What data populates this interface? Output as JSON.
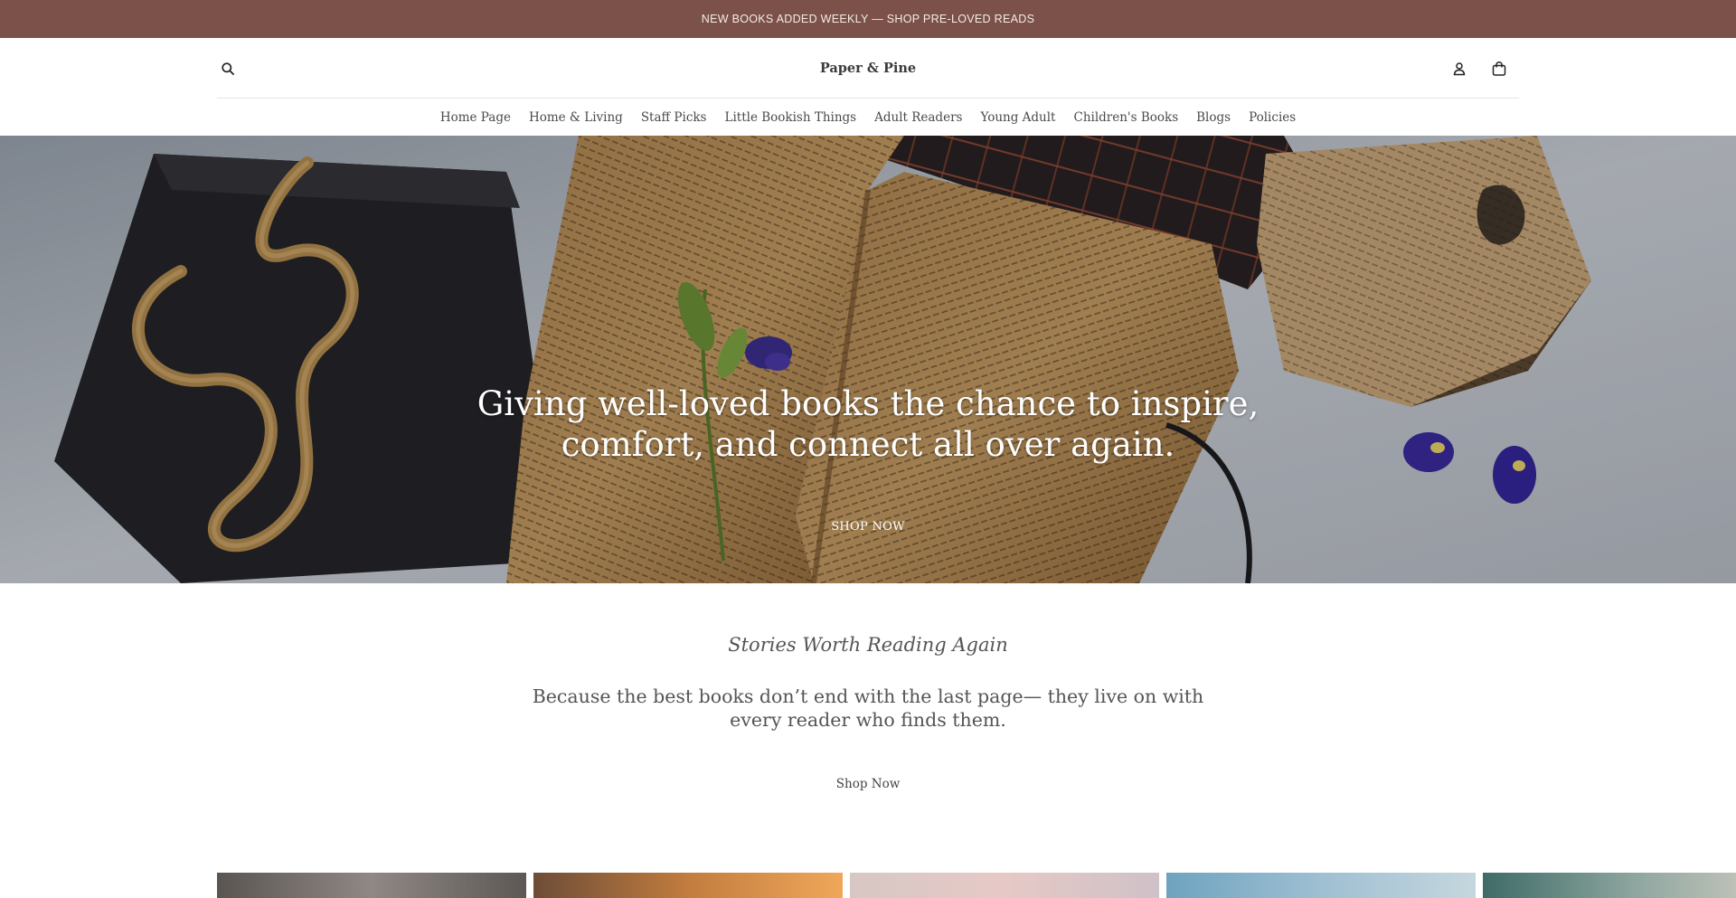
{
  "announcement": "NEW BOOKS ADDED WEEKLY — SHOP PRE-LOVED READS",
  "header": {
    "brand": "Paper & Pine",
    "icons": {
      "search": "search-icon",
      "account": "account-icon",
      "cart": "shopping-bag-icon"
    }
  },
  "nav": {
    "items": [
      "Home Page",
      "Home & Living",
      "Staff Picks",
      "Little Bookish Things",
      "Adult Readers",
      "Young Adult",
      "Children's Books",
      "Blogs",
      "Policies"
    ]
  },
  "hero": {
    "heading": "Giving well-loved books the chance to inspire, comfort, and connect all over again.",
    "cta": "SHOP NOW"
  },
  "intro": {
    "subheading": "Stories Worth Reading Again",
    "tagline": "Because the best books don’t end with the last page— they live on with every reader who finds them.",
    "cta": "Shop Now"
  },
  "colors": {
    "announcement_bg": "#7b5149",
    "announcement_text": "#f4ece8",
    "text": "#4a4a4a",
    "divider": "#e6e6e6"
  }
}
